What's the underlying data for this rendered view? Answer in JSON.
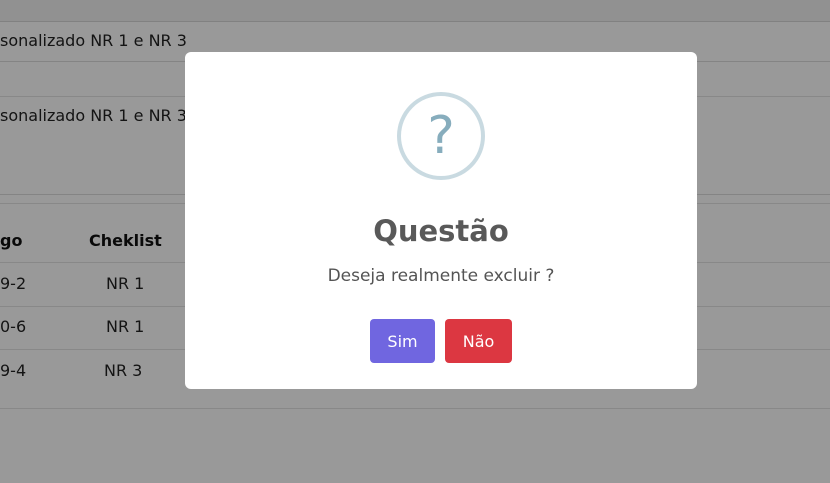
{
  "background": {
    "row_text_1": "sonalizado NR 1 e NR 3",
    "row_text_2": "sonalizado NR 1 e NR 3",
    "table": {
      "headers": [
        "go",
        "Cheklist"
      ],
      "rows": [
        {
          "code": "9-2",
          "checklist": "NR 1"
        },
        {
          "code": "0-6",
          "checklist": "NR 1"
        },
        {
          "code": "9-4",
          "checklist": "NR 3"
        }
      ]
    }
  },
  "modal": {
    "icon": "question-icon",
    "icon_glyph": "?",
    "title": "Questão",
    "message": "Deseja realmente excluir ?",
    "confirm_label": "Sim",
    "cancel_label": "Não"
  },
  "colors": {
    "confirm": "#7066e0",
    "cancel": "#dc3741",
    "icon": "#87adbd",
    "overlay": "rgba(0,0,0,0.4)"
  }
}
